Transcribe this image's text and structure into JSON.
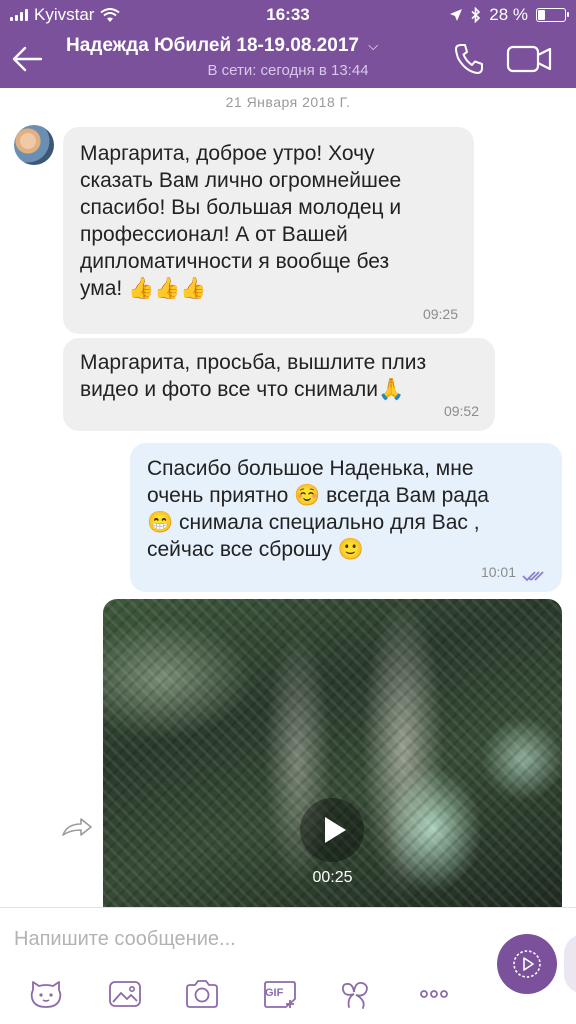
{
  "status_bar": {
    "carrier": "Kyivstar",
    "time": "16:33",
    "battery": "28 %",
    "battery_level": 0.28,
    "icons": [
      "signal-icon",
      "wifi-icon",
      "location-icon",
      "bluetooth-icon",
      "battery-icon"
    ]
  },
  "header": {
    "title": "Надежда Юбилей 18-19.08.2017",
    "status": "В сети: сегодня в 13:44",
    "icons": [
      "back-arrow-icon",
      "chevron-down-icon",
      "phone-icon",
      "video-camera-icon"
    ]
  },
  "chat": {
    "date_separator": "21 Января 2018 Г.",
    "messages": [
      {
        "direction": "incoming",
        "text": "Маргарита, доброе утро! Хочу\nсказать Вам лично огромнейшее\nспасибо! Вы большая молодец и\nпрофессионал! А от Вашей\nдипломатичности я вообще без\nума! 👍👍👍",
        "time": "09:25"
      },
      {
        "direction": "incoming",
        "text": "Маргарита, просьба, вышлите плиз\nвидео и фото все что снимали🙏",
        "time": "09:52"
      },
      {
        "direction": "outgoing",
        "text": "Спасибо большое Наденька, мне\nочень приятно ☺️ всегда Вам рада\n😁 снимала специально для Вас ,\nсейчас все сброшу 🙂",
        "time": "10:01",
        "status_icon": "double-check-icon"
      }
    ],
    "video": {
      "duration": "00:25",
      "icons": [
        "play-icon",
        "forward-icon"
      ]
    }
  },
  "composer": {
    "placeholder": "Напишите сообщение...",
    "tools": [
      "sticker-icon",
      "gallery-icon",
      "camera-icon",
      "gif-icon",
      "doodle-icon",
      "more-icon"
    ],
    "gif_label": "GIF",
    "more_label": "ooo"
  },
  "colors": {
    "brand": "#7b519c",
    "incoming_bubble": "#efefef",
    "outgoing_bubble": "#e6f1fb",
    "read_ticks": "#8b7fd6"
  }
}
